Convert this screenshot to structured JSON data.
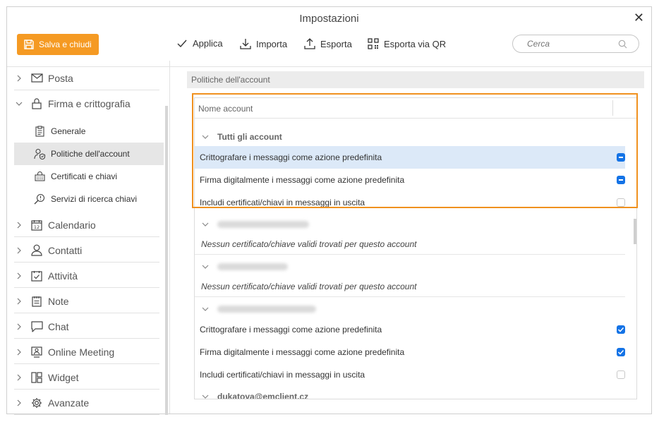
{
  "window": {
    "title": "Impostazioni",
    "close_glyph": "✕"
  },
  "toolbar": {
    "save_label": "Salva e chiudi",
    "apply_label": "Applica",
    "import_label": "Importa",
    "export_label": "Esporta",
    "export_qr_label": "Esporta via QR",
    "search_placeholder": "Cerca"
  },
  "sidebar": {
    "items": [
      {
        "label": "Posta",
        "icon": "mail-icon",
        "expanded": false
      },
      {
        "label": "Firma e crittografia",
        "icon": "lock-icon",
        "expanded": true
      },
      {
        "label": "Calendario",
        "icon": "calendar-icon",
        "expanded": false
      },
      {
        "label": "Contatti",
        "icon": "person-icon",
        "expanded": false
      },
      {
        "label": "Attività",
        "icon": "task-icon",
        "expanded": false
      },
      {
        "label": "Note",
        "icon": "note-icon",
        "expanded": false
      },
      {
        "label": "Chat",
        "icon": "chat-icon",
        "expanded": false
      },
      {
        "label": "Online Meeting",
        "icon": "meeting-icon",
        "expanded": false
      },
      {
        "label": "Widget",
        "icon": "widget-icon",
        "expanded": false
      },
      {
        "label": "Avanzate",
        "icon": "gear-icon",
        "expanded": false
      }
    ],
    "subitems": [
      {
        "label": "Generale",
        "icon": "clipboard-icon",
        "active": false
      },
      {
        "label": "Politiche dell'account",
        "icon": "user-shield-icon",
        "active": true
      },
      {
        "label": "Certificati e chiavi",
        "icon": "certificate-icon",
        "active": false
      },
      {
        "label": "Servizi di ricerca chiavi",
        "icon": "key-search-icon",
        "active": false
      }
    ]
  },
  "main": {
    "section_title": "Politiche dell'account",
    "table": {
      "column_header": "Nome account",
      "all_accounts": {
        "name": "Tutti gli account",
        "rows": [
          {
            "label": "Crittografare i messaggi come azione predefinita",
            "state": "indeterminate",
            "selected": true
          },
          {
            "label": "Firma digitalmente i messaggi come azione predefinita",
            "state": "indeterminate",
            "selected": false
          },
          {
            "label": "Includi certificati/chiavi in messaggi in uscita",
            "state": "unchecked",
            "selected": false
          }
        ]
      },
      "no_cert_message": "Nessun certificato/chiave validi trovati per questo account",
      "third_account_rows": [
        {
          "label": "Crittografare i messaggi come azione predefinita",
          "state": "checked"
        },
        {
          "label": "Firma digitalmente i messaggi come azione predefinita",
          "state": "checked"
        },
        {
          "label": "Includi certificati/chiavi in messaggi in uscita",
          "state": "unchecked"
        }
      ],
      "last_account": "dukatova@emclient.cz"
    }
  },
  "colors": {
    "accent": "#f59a23",
    "highlight": "#f0911f",
    "checkbox": "#1473e6",
    "selected_row": "#dce9f8"
  }
}
